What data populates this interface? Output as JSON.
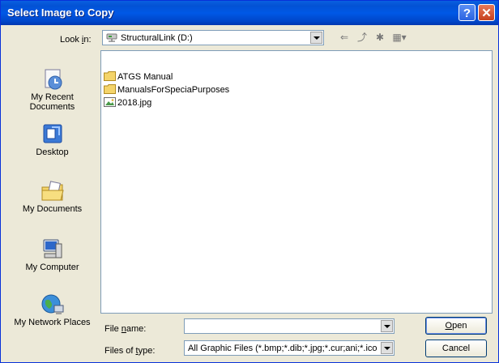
{
  "window": {
    "title": "Select Image to Copy",
    "help_glyph": "?",
    "close_glyph": "✕"
  },
  "lookin": {
    "label_pre": "Look ",
    "label_hotkey": "i",
    "label_post": "n:",
    "value": "StructuralLink (D:)"
  },
  "toolbar": {
    "back_glyph": "⇐",
    "up_glyph": "⤴",
    "newfolder_glyph": "✱",
    "views_glyph": "▦▾"
  },
  "places": [
    {
      "label": "My Recent Documents"
    },
    {
      "label": "Desktop"
    },
    {
      "label": "My Documents"
    },
    {
      "label": "My Computer"
    },
    {
      "label": "My Network Places"
    }
  ],
  "files": [
    {
      "name": "ATGS Manual",
      "type": "folder"
    },
    {
      "name": "ManualsForSpeciaPurposes",
      "type": "folder"
    },
    {
      "name": "2018.jpg",
      "type": "image"
    }
  ],
  "filename": {
    "label_pre": "File ",
    "label_hotkey": "n",
    "label_post": "ame:",
    "value": ""
  },
  "filetype": {
    "label_pre": "Files of ",
    "label_hotkey": "t",
    "label_post": "ype:",
    "value": "All Graphic Files (*.bmp;*.dib;*.jpg;*.cur;ani;*.ico"
  },
  "buttons": {
    "open_hotkey": "O",
    "open_rest": "pen",
    "cancel": "Cancel"
  },
  "colors": {
    "title_bar": "#0058e6",
    "window_bg": "#ece9d8",
    "folder": "#f4d46a"
  }
}
